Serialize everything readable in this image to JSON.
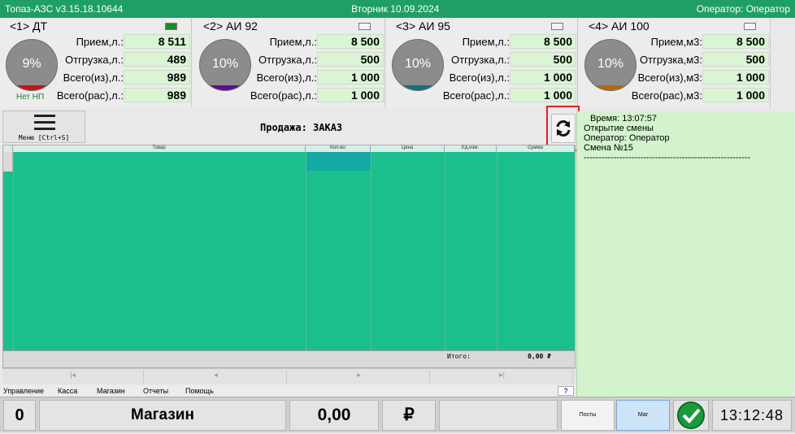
{
  "titlebar": {
    "app": "Топаз-АЗС  v3.15.18.10644",
    "date": "Вторник 10.09.2024",
    "operator": "Оператор: Оператор"
  },
  "tanks": [
    {
      "title": "<1> ДТ",
      "percent": "9%",
      "fill_color": "#c21414",
      "indicator_color": "#1e8a2a",
      "status": "Нет НП",
      "rows": [
        {
          "label": "Прием,л.:",
          "value": "8 511"
        },
        {
          "label": "Отгрузка,л.:",
          "value": "489"
        },
        {
          "label": "Всего(из),л.:",
          "value": "989"
        },
        {
          "label": "Всего(рас),л.:",
          "value": "989"
        }
      ]
    },
    {
      "title": "<2> АИ 92",
      "percent": "10%",
      "fill_color": "#5b0e91",
      "indicator_color": "#f4f4f4",
      "status": "",
      "rows": [
        {
          "label": "Прием,л.:",
          "value": "8 500"
        },
        {
          "label": "Отгрузка,л.:",
          "value": "500"
        },
        {
          "label": "Всего(из),л.:",
          "value": "1 000"
        },
        {
          "label": "Всего(рас),л.:",
          "value": "1 000"
        }
      ]
    },
    {
      "title": "<3> АИ 95",
      "percent": "10%",
      "fill_color": "#17707a",
      "indicator_color": "#f4f4f4",
      "status": "",
      "rows": [
        {
          "label": "Прием,л.:",
          "value": "8 500"
        },
        {
          "label": "Отгрузка,л.:",
          "value": "500"
        },
        {
          "label": "Всего(из),л.:",
          "value": "1 000"
        },
        {
          "label": "Всего(рас),л.:",
          "value": "1 000"
        }
      ]
    },
    {
      "title": "<4> АИ 100",
      "percent": "10%",
      "fill_color": "#b5680b",
      "indicator_color": "#f4f4f4",
      "status": "",
      "rows": [
        {
          "label": "Прием,м3:",
          "value": "8 500"
        },
        {
          "label": "Отгрузка,м3:",
          "value": "500"
        },
        {
          "label": "Всего(из),м3:",
          "value": "1 000"
        },
        {
          "label": "Всего(рас),м3:",
          "value": "1 000"
        }
      ]
    }
  ],
  "menu": {
    "label": "Меню [Ctrl+S]",
    "icon": "hamburger-icon"
  },
  "sale_title": "Продажа: ЗАКАЗ",
  "refresh_icon": "refresh-icon",
  "log": {
    "lines": [
      "Время: 13:07:57",
      "Открытие смены",
      "Оператор: Оператор",
      "Смена №15",
      "--------------------------------------------------------"
    ]
  },
  "grid": {
    "columns": [
      "Товар",
      "Кол-во",
      "Цена",
      "Ед.изм.",
      "Сумма"
    ],
    "total_label": "Итого:",
    "total_value": "0,00 ₽"
  },
  "nav": [
    "|◂",
    "◂",
    "▸",
    "▸|"
  ],
  "menubar": [
    "Управление",
    "Касса",
    "Магазин",
    "Отчеты",
    "Помощь"
  ],
  "help_icon": "?",
  "status": {
    "count": "0",
    "section": "Магазин",
    "amount": "0,00",
    "currency": "₽",
    "btn_posts": "Посты",
    "btn_mag": "Маг",
    "time": "13:12:48"
  }
}
